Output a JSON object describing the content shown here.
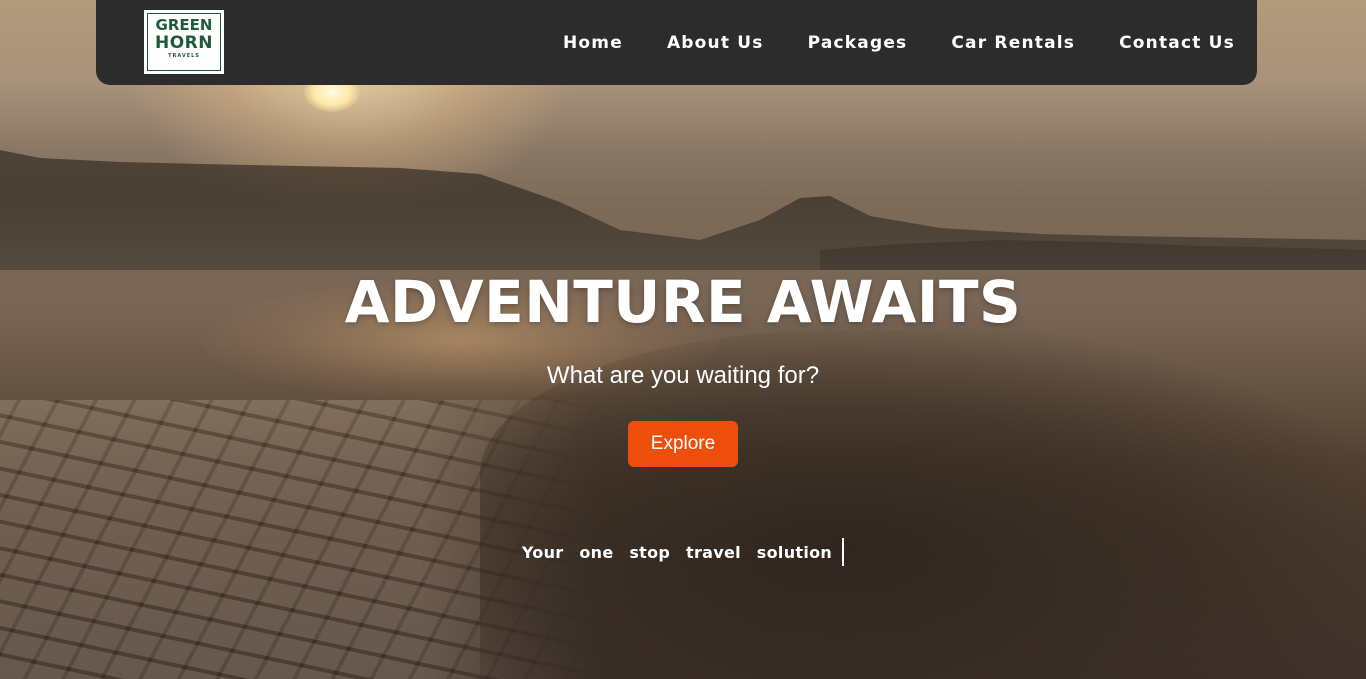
{
  "brand": {
    "logo_line1": "GREEN",
    "logo_line2": "HORN",
    "logo_line3": "TRAVELS",
    "logo_color": "#1f5a3a"
  },
  "nav": {
    "background": "#2c2c2c",
    "items": [
      {
        "label": "Home"
      },
      {
        "label": "About Us"
      },
      {
        "label": "Packages"
      },
      {
        "label": "Car Rentals"
      },
      {
        "label": "Contact Us"
      }
    ]
  },
  "hero": {
    "headline": "ADVENTURE AWAITS",
    "subheadline": "What are you waiting for?",
    "cta_label": "Explore",
    "cta_color": "#ee4e0c",
    "tagline": "Your one stop travel solution"
  }
}
